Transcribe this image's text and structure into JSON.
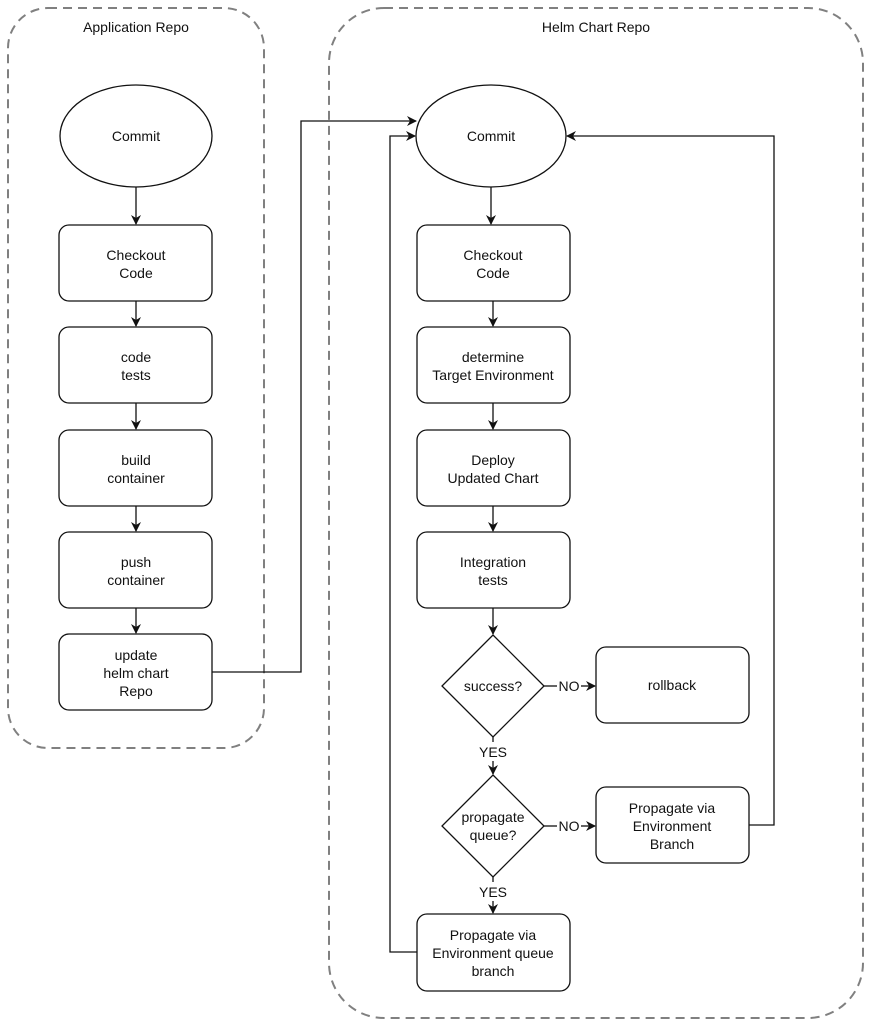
{
  "groups": {
    "application_repo": {
      "title": "Application Repo"
    },
    "helm_chart_repo": {
      "title": "Helm Chart Repo"
    }
  },
  "app_nodes": {
    "commit": "Commit",
    "checkout": [
      "Checkout",
      "Code"
    ],
    "code_tests": [
      "code",
      "tests"
    ],
    "build_container": [
      "build",
      "container"
    ],
    "push_container": [
      "push",
      "container"
    ],
    "update_helm": [
      "update",
      "helm chart",
      "Repo"
    ]
  },
  "helm_nodes": {
    "commit": "Commit",
    "checkout": [
      "Checkout",
      "Code"
    ],
    "determine_env": [
      "determine",
      "Target Environment"
    ],
    "deploy_chart": [
      "Deploy",
      "Updated Chart"
    ],
    "integration_tests": [
      "Integration",
      "tests"
    ],
    "success_decision": "success?",
    "rollback": "rollback",
    "propagate_decision": [
      "propagate",
      "queue?"
    ],
    "propagate_env_branch": [
      "Propagate via",
      "Environment",
      "Branch"
    ],
    "propagate_queue_branch": [
      "Propagate via",
      "Environment queue",
      "branch"
    ]
  },
  "edge_labels": {
    "success_no": "NO",
    "success_yes": "YES",
    "propagate_no": "NO",
    "propagate_yes": "YES"
  },
  "colors": {
    "stroke": "#111111",
    "group_border": "#808080",
    "fill": "#ffffff"
  }
}
